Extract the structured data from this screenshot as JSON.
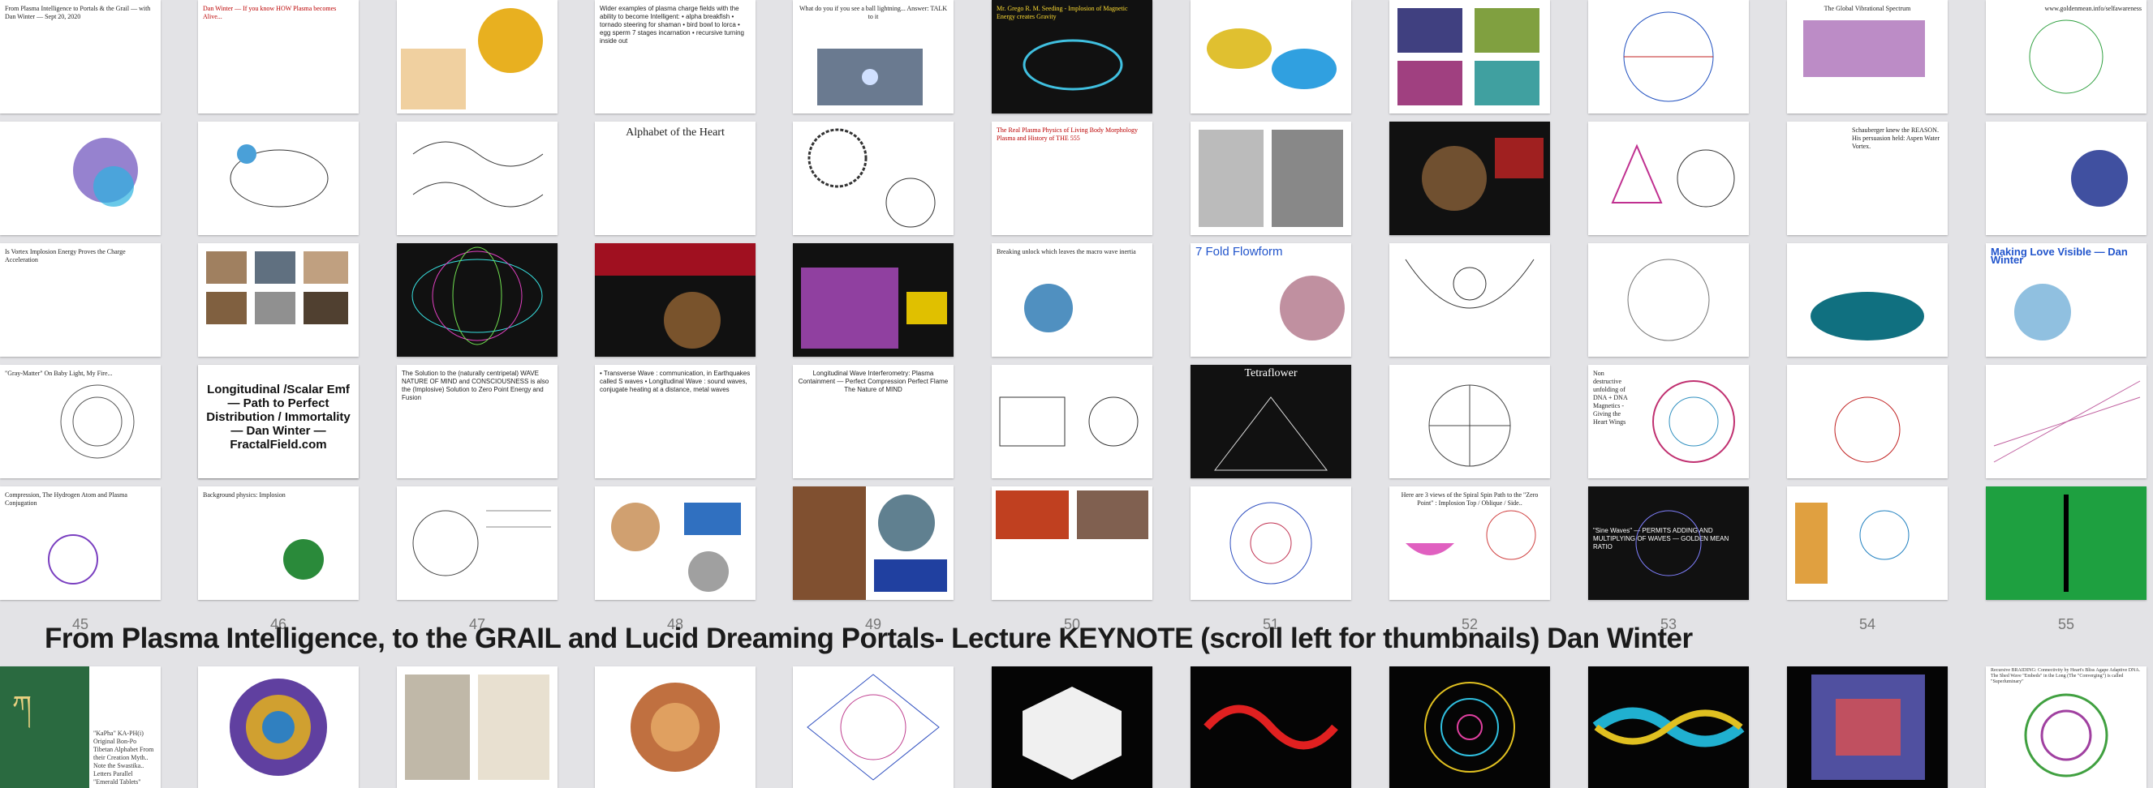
{
  "banner": {
    "title": "From Plasma Intelligence, to the GRAIL and Lucid Dreaming Portals- Lecture KEYNOTE (scroll left for thumbnails)    Dan Winter"
  },
  "slide_numbers": [
    "45",
    "46",
    "47",
    "48",
    "49",
    "50",
    "51",
    "52",
    "53",
    "54",
    "55"
  ],
  "slides": {
    "c0r0": "From Plasma Intelligence to Portals & the Grail — with Dan Winter — Sept 20, 2020",
    "c0r2": "Is Vortex Implosion Energy Proves the Charge Acceleration",
    "c0r3": "\"Gray-Matter\" On Baby Light, My Fire...",
    "c0r4": "Compression, The Hydrogen Atom and Plasma Conjugation",
    "c1r0": "Dan Winter — If you know HOW Plasma becomes Alive...",
    "c1r4": "Background physics: Implosion",
    "c2r0": "The Solution to the (naturally centripetal)",
    "c2r3": "The Solution to the (naturally centripetal) WAVE NATURE OF MIND and CONSCIOUSNESS is also the (Implosive) Solution to Zero Point Energy and Fusion",
    "c2r2": "Longitudinal /Scalar Emf — Path to Perfect Distribution / Immortality — Dan Winter — FractalField.com",
    "c3r0": "Wider examples of plasma charge fields with the ability to become Intelligent: • alpha breakfish • tornado steering for shaman • bird bowl to lorca • egg sperm 7 stages incarnation • recursive turning inside out",
    "c3r1": "Alphabet of the Heart",
    "c3r3": "• Transverse Wave : communication, in Earthquakes called S waves • Longitudinal Wave : sound waves, conjugate heating at a distance, metal waves",
    "c4r3": "Longitudinal Wave Interferometry: Plasma Containment — Perfect Compression Perfect Flame The Nature of MIND",
    "c4r0": "What do you if you see a ball lightning... Answer: TALK to it",
    "c5r0": "Mr. Grego R. M. Seeding - Implosion of Magnetic Energy creates Gravity",
    "c5r1": "The Real Plasma Physics of Living Body Morphology Plasma and History of THE 555",
    "c5r2": "Breaking unlock which leaves the macro wave inertia",
    "c6r2": "7 Fold Flowform",
    "c6r3": "Tetraflower",
    "c7r4": "Here are 3 views of the Spiral Spin Path to the \"Zero Point\" : Implosion Top / Oblique / Side..",
    "c8r4": "\"Sine Waves\" — PERMITS ADDING AND MULTIPLYING OF WAVES — GOLDEN MEAN RATIO",
    "c8r3": "Non destructive unfolding of DNA + DNA Magnetics - Giving the Heart Wings",
    "c9r0": "The Global Vibrational Spectrum",
    "c9r1": "Schauberger knew the REASON. His persuasion held: Aspen Water Vortex.",
    "c10r2": "Making Love Visible — Dan Winter",
    "c10r0": "www.goldenmean.info/selfawareness"
  },
  "bottom_captions": {
    "b0": "\"KaPha\" KA-PH(i) Original Bon-Po Tibetan Alphabet From their Creation Myth.. Note the Swastika.. Letters Parallel \"Emerald Tablets\"",
    "b10": "Recursive BRAIDING: Connectivity by Heart's Bliss Agape Adaptive DNA. The Shed Wave \"Embeds\" in the Long (The \"Converging\") is called \"Superluminary\""
  },
  "colors": {
    "background": "#e3e3e6",
    "title": "#1b1b1b",
    "slide_number": "#777777"
  }
}
